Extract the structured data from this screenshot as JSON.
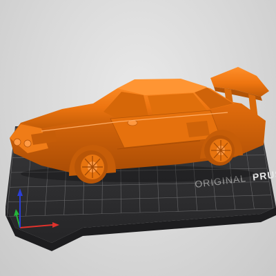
{
  "scene": {
    "bed_brand_prefix": "ORIGINAL",
    "bed_brand_name": "PRUSA",
    "model_color": "#F07A12",
    "model_shadow_color": "#B65308",
    "bed_color": "#2f2f31",
    "grid_color": "#6a6a6c",
    "background_color": "#d9d9d9"
  },
  "axes": {
    "x_color": "#e0322c",
    "y_color": "#25b43b",
    "z_color": "#2b3fd6"
  }
}
